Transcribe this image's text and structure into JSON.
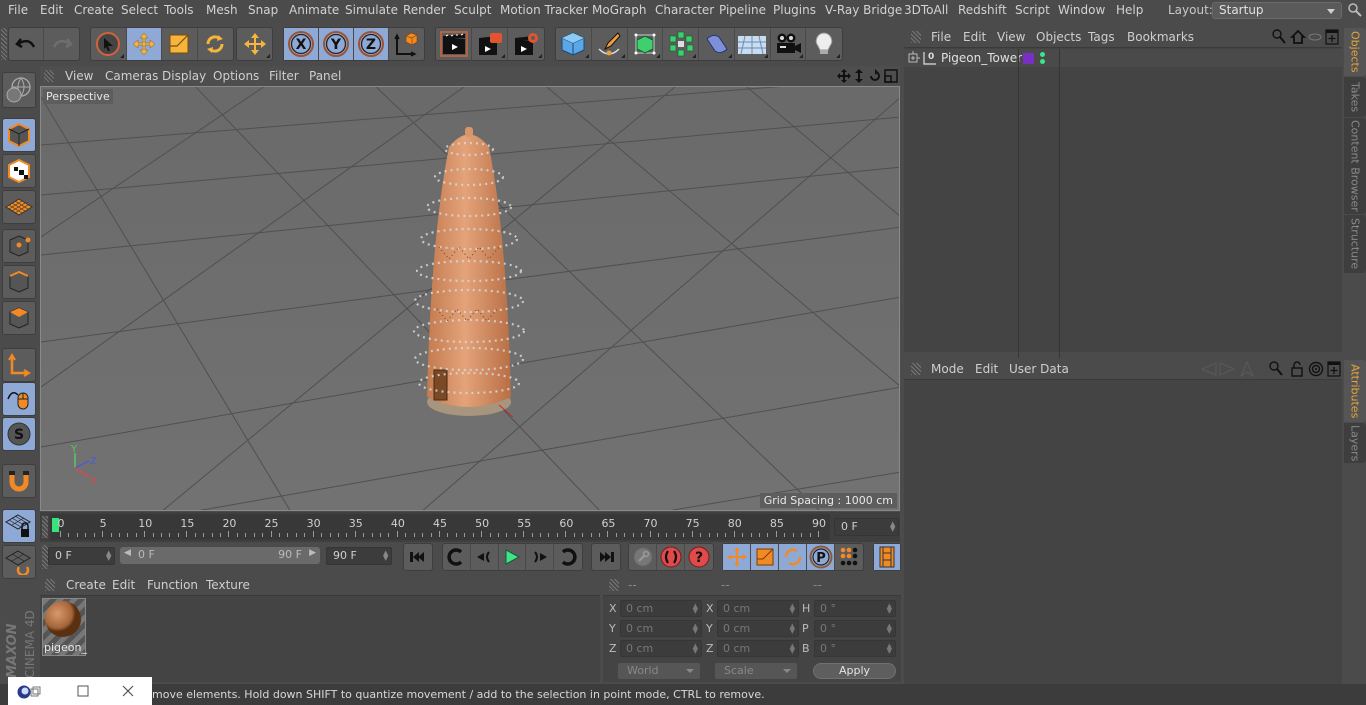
{
  "menubar": {
    "items": [
      "File",
      "Edit",
      "Create",
      "Select",
      "Tools",
      "Mesh",
      "Snap",
      "Animate",
      "Simulate",
      "Render",
      "Sculpt",
      "Motion Tracker",
      "MoGraph",
      "Character",
      "Pipeline",
      "Plugins",
      "V-Ray Bridge",
      "3DToAll",
      "Redshift",
      "Script",
      "Window",
      "Help"
    ],
    "layout_label": "Layout:",
    "layout_value": "Startup"
  },
  "toolbar": {
    "groups": [
      {
        "name": "history",
        "buttons": [
          "undo",
          "redo"
        ]
      },
      {
        "name": "tools",
        "buttons": [
          "live-selection",
          "move",
          "scale",
          "rotate"
        ]
      },
      {
        "name": "recent",
        "buttons": [
          "last-tool"
        ]
      },
      {
        "name": "axes",
        "buttons": [
          "x-axis",
          "y-axis",
          "z-axis",
          "coordinate-system"
        ]
      },
      {
        "name": "render",
        "buttons": [
          "render-view",
          "render-picture-viewer",
          "edit-render-settings"
        ]
      },
      {
        "name": "objects",
        "buttons": [
          "cube",
          "pen",
          "subdivision-surface",
          "cloner",
          "deformer",
          "floor",
          "camera",
          "light"
        ]
      }
    ]
  },
  "viewport": {
    "menu": [
      "View",
      "Cameras",
      "Display",
      "Options",
      "Filter",
      "Panel"
    ],
    "label": "Perspective",
    "grid_spacing": "Grid Spacing : 1000 cm",
    "axis_labels": {
      "x": "X",
      "y": "Y",
      "z": "Z"
    }
  },
  "timeline": {
    "ticks": [
      "0",
      "5",
      "10",
      "15",
      "20",
      "25",
      "30",
      "35",
      "40",
      "45",
      "50",
      "55",
      "60",
      "65",
      "70",
      "75",
      "80",
      "85",
      "90"
    ],
    "current_frame_field": "0 F",
    "start_field": "0 F",
    "range_start": "0 F",
    "range_end": "90 F",
    "end_field": "90 F",
    "current_frame": 0,
    "max_frame": 90
  },
  "material_manager": {
    "menu": [
      "Create",
      "Edit",
      "Function",
      "Texture"
    ],
    "materials": [
      {
        "name": "pigeon_"
      }
    ]
  },
  "coordinates": {
    "headers": [
      "--",
      "--",
      "--"
    ],
    "position": [
      {
        "axis": "X",
        "value": "0 cm"
      },
      {
        "axis": "Y",
        "value": "0 cm"
      },
      {
        "axis": "Z",
        "value": "0 cm"
      }
    ],
    "size": [
      {
        "axis": "X",
        "value": "0 cm"
      },
      {
        "axis": "Y",
        "value": "0 cm"
      },
      {
        "axis": "Z",
        "value": "0 cm"
      }
    ],
    "rotation": [
      {
        "axis": "H",
        "value": "0 °"
      },
      {
        "axis": "P",
        "value": "0 °"
      },
      {
        "axis": "B",
        "value": "0 °"
      }
    ],
    "coord_mode": "World",
    "size_mode": "Scale",
    "apply_label": "Apply"
  },
  "object_manager": {
    "menu": [
      "File",
      "Edit",
      "View",
      "Objects",
      "Tags",
      "Bookmarks"
    ],
    "objects": [
      {
        "name": "Pigeon_Tower",
        "layer_color": "#7a2fc4"
      }
    ]
  },
  "attribute_manager": {
    "menu": [
      "Mode",
      "Edit",
      "User Data"
    ]
  },
  "side_tabs": {
    "top": [
      "Objects",
      "Takes",
      "Content Browser",
      "Structure"
    ],
    "bottom": [
      "Attributes",
      "Layers"
    ]
  },
  "branding": {
    "maxon": "MAXON",
    "product": "CINEMA 4D"
  },
  "status": {
    "text": "move elements. Hold down SHIFT to quantize movement / add to the selection in point mode, CTRL to remove."
  },
  "colors": {
    "accent_active": "#8ea9d6",
    "tab_active": "#e8a43a",
    "play_green": "#3ee38a",
    "tower": "#d9956a"
  }
}
